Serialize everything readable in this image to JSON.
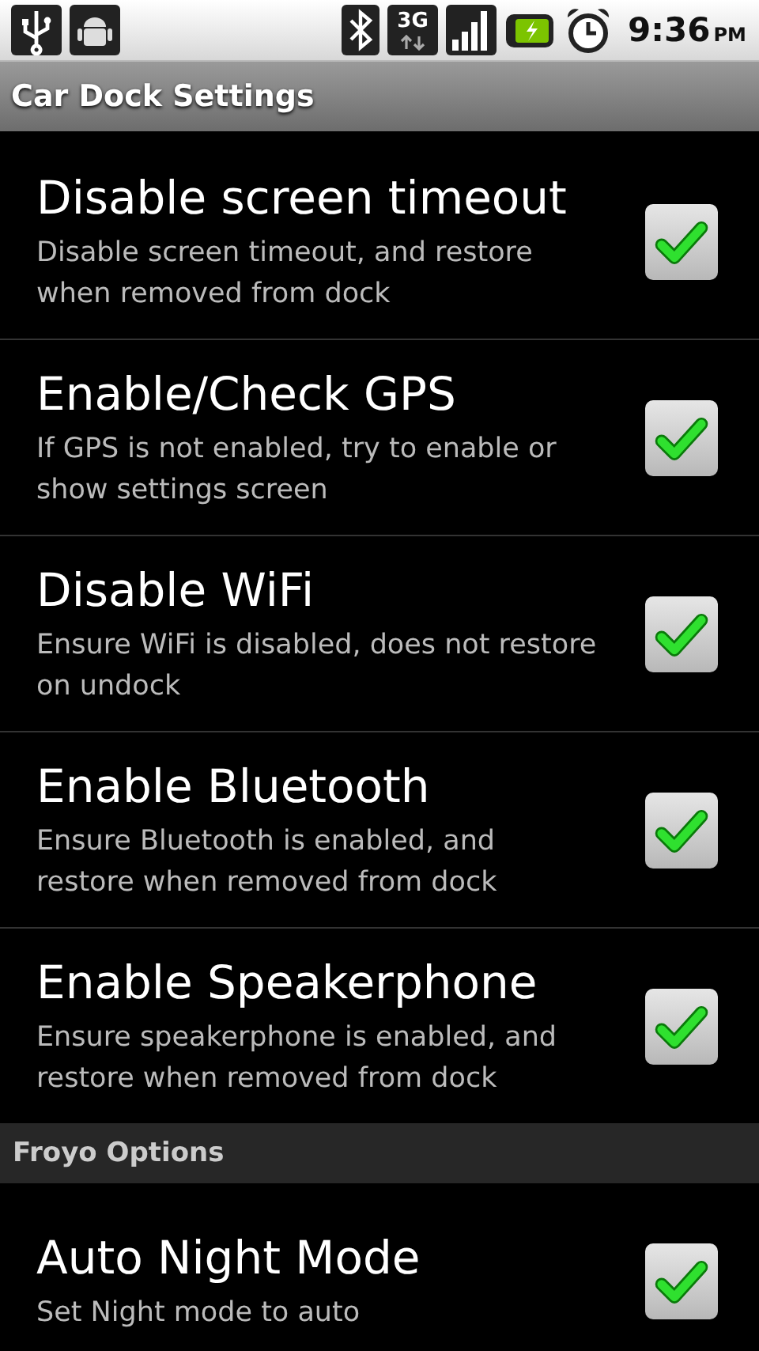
{
  "status_bar": {
    "network_label": "3G",
    "time": "9:36",
    "am_pm": "PM"
  },
  "title_bar": {
    "title": "Car Dock Settings"
  },
  "sections": [
    {
      "items": [
        {
          "title": "Disable screen timeout",
          "summary": "Disable screen timeout, and restore when removed from dock",
          "checked": true
        },
        {
          "title": "Enable/Check GPS",
          "summary": "If GPS is not enabled, try to enable or show settings screen",
          "checked": true
        },
        {
          "title": "Disable WiFi",
          "summary": "Ensure WiFi is disabled, does not restore on undock",
          "checked": true
        },
        {
          "title": "Enable Bluetooth",
          "summary": "Ensure Bluetooth is enabled, and restore when removed from dock",
          "checked": true
        },
        {
          "title": "Enable Speakerphone",
          "summary": "Ensure speakerphone is enabled, and restore when removed from dock",
          "checked": true
        }
      ]
    },
    {
      "header": "Froyo Options",
      "items": [
        {
          "title": "Auto Night Mode",
          "summary": "Set Night mode to auto",
          "checked": true
        }
      ]
    }
  ]
}
